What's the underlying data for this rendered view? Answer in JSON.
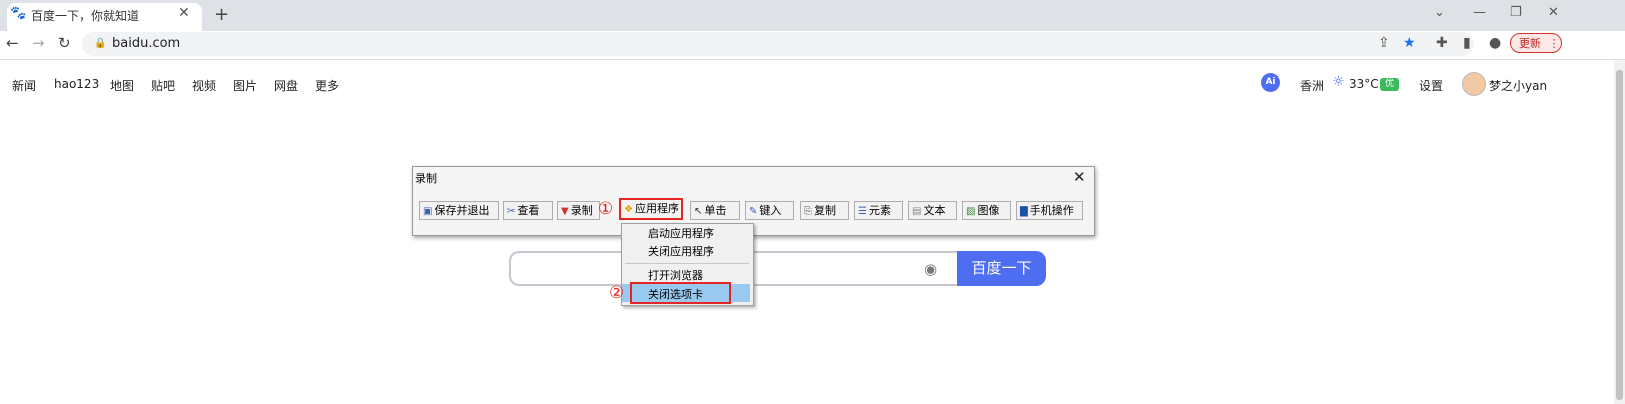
{
  "browser": {
    "tab_title": "百度一下，你就知道",
    "url": "baidu.com",
    "update_label": "更新",
    "icons": {
      "favicon": "baidu-paw-icon",
      "close": "close-icon",
      "new_tab": "plus-icon",
      "back": "back-arrow-icon",
      "forward": "forward-arrow-icon",
      "reload": "reload-icon",
      "lock": "lock-icon",
      "share": "share-icon",
      "bookmark": "star-icon",
      "extensions": "puzzle-icon",
      "sidepanel": "side-panel-icon",
      "profile": "profile-icon",
      "menu": "kebab-menu-icon"
    },
    "icon_glyphs": {
      "favicon": "🐾",
      "close": "✕",
      "new_tab": "+",
      "back": "←",
      "forward": "→",
      "reload": "↻",
      "lock": "🔒",
      "share": "⇪",
      "bookmark": "★",
      "extensions": "✚",
      "sidepanel": "▮",
      "profile": "●",
      "menu": "⋮",
      "minimize": "—",
      "restore": "❐",
      "window_close": "✕",
      "chevron": "⌄"
    }
  },
  "baidu": {
    "nav_items": [
      "新闻",
      "hao123",
      "地图",
      "贴吧",
      "视频",
      "图片",
      "网盘",
      "更多"
    ],
    "right": {
      "ai_label": "Ai",
      "city": "香洲",
      "temperature": "33°C",
      "aqi": "优",
      "settings": "设置",
      "username": "梦之小yan"
    },
    "search_button": "百度一下",
    "search_value": ""
  },
  "recorder": {
    "title": "录制",
    "buttons": [
      "保存并退出",
      "查看",
      "录制",
      "应用程序",
      "单击",
      "键入",
      "复制",
      "元素",
      "文本",
      "图像",
      "手机操作"
    ],
    "menu_items": [
      "启动应用程序",
      "关闭应用程序",
      "打开浏览器",
      "关闭选项卡"
    ],
    "annotations": [
      "①",
      "②"
    ],
    "highlight_color": "#e32525"
  }
}
